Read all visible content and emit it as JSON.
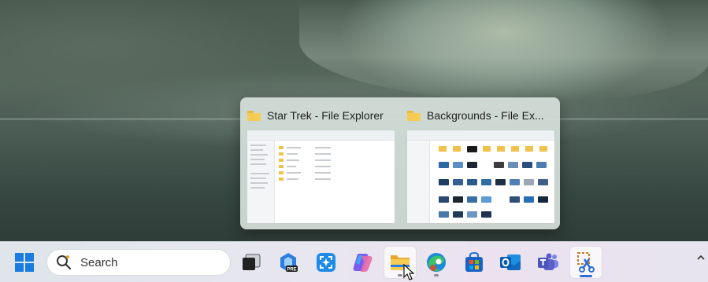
{
  "thumbnails": [
    {
      "title": "Star Trek - File Explorer"
    },
    {
      "title": "Backgrounds - File Ex..."
    }
  ],
  "taskbar": {
    "search": {
      "placeholder": "Search"
    }
  },
  "colors": {
    "accent": "#2b6fd6",
    "folder": "#f5cc53"
  }
}
